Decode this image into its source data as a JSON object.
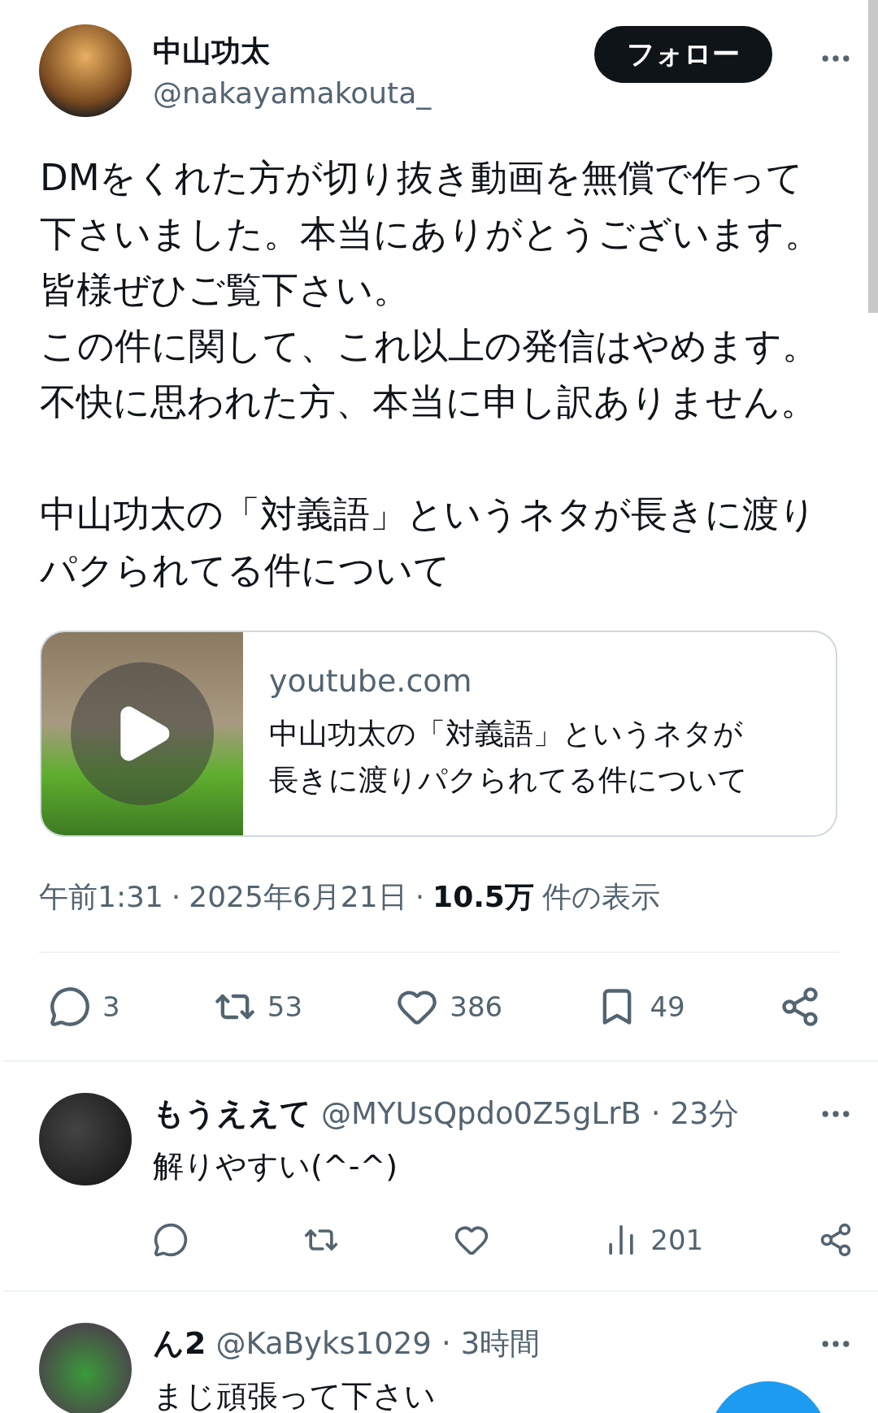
{
  "author": {
    "name": "中山功太",
    "handle": "@nakayamakouta_"
  },
  "follow_button": "フォロー",
  "paragraphs": [
    [
      "DMをくれた方が切り抜き動画を無償で作って",
      "下さいました。本当にありがとうございます。",
      "皆様ぜひご覧下さい。",
      "この件に関して、これ以上の発信はやめます。",
      "不快に思われた方、本当に申し訳ありません。"
    ],
    [
      "中山功太の「対義語」というネタが長きに渡り",
      "パクられてる件について"
    ]
  ],
  "link_card": {
    "domain": "youtube.com",
    "title_lines": [
      "中山功太の「対義語」というネタが",
      "長きに渡りパクられてる件について"
    ]
  },
  "meta": {
    "time": "午前1:31",
    "sep": "·",
    "date": "2025年6月21日",
    "sep_2": "·",
    "views": "10.5万",
    "views_label": "件の表示"
  },
  "actions": [
    {
      "kind": "reply",
      "count": "3"
    },
    {
      "kind": "retweet",
      "count": "53"
    },
    {
      "kind": "like",
      "count": "386"
    },
    {
      "kind": "bookmark",
      "count": "49"
    },
    {
      "kind": "share"
    }
  ],
  "replies": [
    {
      "name": "もうええて",
      "handle": "@MYUsQpdo0Z5gLrB",
      "sep": "·",
      "time": "23分",
      "text": "解りやすい(^-^)",
      "actions": [
        {
          "kind": "reply"
        },
        {
          "kind": "retweet"
        },
        {
          "kind": "like"
        },
        {
          "kind": "views",
          "count": "201"
        },
        {
          "kind": "share"
        }
      ]
    },
    {
      "name": "ん2",
      "handle": "@KaByks1029",
      "sep": "·",
      "time": "3時間",
      "text": "まじ頑張って下さい"
    }
  ]
}
